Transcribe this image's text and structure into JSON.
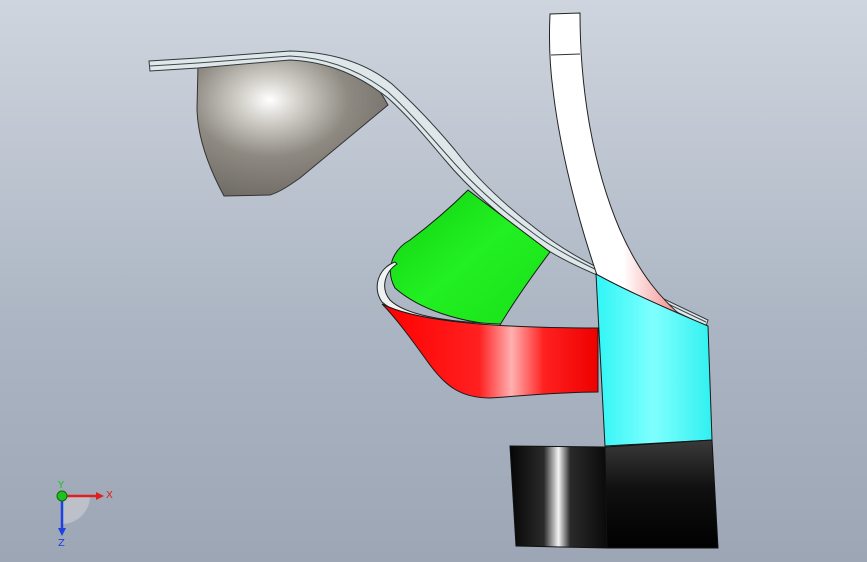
{
  "viewport": {
    "background_top": "#cfd5de",
    "background_bottom": "#9ca6b5"
  },
  "model": {
    "parts": [
      {
        "name": "grey-shell-surface",
        "color": "#8e8a82"
      },
      {
        "name": "green-blade-surface",
        "color": "#22e022"
      },
      {
        "name": "red-blade-surface",
        "color": "#ff1010"
      },
      {
        "name": "pink-vane-surface",
        "color": "#f6a0a0"
      },
      {
        "name": "cyan-band-surface",
        "color": "#40ffff"
      },
      {
        "name": "black-hub-surface",
        "color": "#101010"
      }
    ]
  },
  "triad": {
    "x_label": "X",
    "y_label": "Y",
    "z_label": "Z",
    "x_color": "#e02020",
    "y_color": "#20c020",
    "z_color": "#2040e0"
  }
}
